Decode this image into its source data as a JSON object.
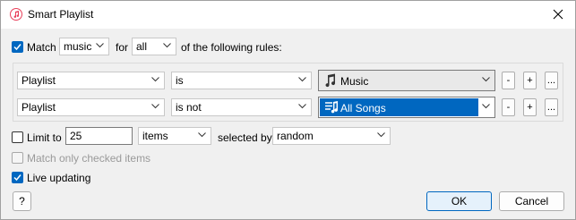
{
  "window": {
    "title": "Smart Playlist",
    "close_symbol": "✕"
  },
  "match_row": {
    "match_label": "Match",
    "match_checked": true,
    "media_value": "music",
    "for_label": "for",
    "quantifier_value": "all",
    "suffix": "of the following rules:"
  },
  "rules": [
    {
      "field": "Playlist",
      "operator": "is",
      "value": "Music",
      "value_icon": "music-note-icon"
    },
    {
      "field": "Playlist",
      "operator": "is not",
      "value": "All Songs",
      "value_icon": "playlist-icon"
    }
  ],
  "rule_buttons": {
    "remove": "-",
    "add": "+",
    "more": "..."
  },
  "limit_row": {
    "limit_label": "Limit to",
    "limit_checked": false,
    "limit_value": "25",
    "unit_value": "items",
    "selected_by_label": "selected by",
    "selected_by_value": "random"
  },
  "match_checked_label": "Match only checked items",
  "live_updating_label": "Live updating",
  "live_updating_checked": true,
  "buttons": {
    "help": "?",
    "ok": "OK",
    "cancel": "Cancel"
  },
  "colors": {
    "accent": "#0067c0",
    "icon": "#e8405a"
  }
}
